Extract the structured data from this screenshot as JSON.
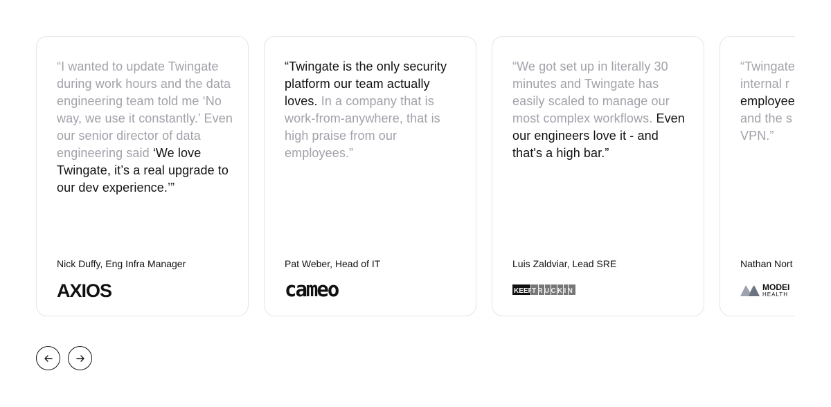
{
  "testimonials": [
    {
      "quote_muted": "“I wanted to update Twingate during work hours and the data engineering team told me ‘No way, we use it constantly.’ Even our senior director of data engineering said ",
      "quote_highlight": "‘We love Twingate, it’s a real upgrade to our dev experience.’”",
      "quote_tail": "",
      "author": "Nick Duffy, Eng Infra Manager",
      "logo": "AXIOS"
    },
    {
      "quote_muted": "",
      "quote_highlight": "“Twingate is the only security platform our team actually loves.",
      "quote_tail": " In a company that is work-from-anywhere, that is high praise from our employees.”",
      "author": "Pat Weber, Head of IT",
      "logo": "cameo"
    },
    {
      "quote_muted": "“We got set up in literally 30 minutes and Twingate has easily scaled to manage our most complex workflows.",
      "quote_highlight": " Even our engineers love it - and that's a high bar.”",
      "quote_tail": "",
      "author": "Luis Zaldviar, Lead SRE",
      "logo": "KEEPTRUCKIN",
      "logo_keep": "KEEP",
      "logo_truckin": "TRUCKIN"
    },
    {
      "quote_muted": "“Twingate puzzle pie our acces internal r",
      "quote_highlight": "employee",
      "quote_tail": "and the s sleep bet that we u VPN.”",
      "author": "Nathan Nort",
      "logo": "MODERN HEALTH",
      "logo_top": "MODEI",
      "logo_bottom": "HEALTH"
    }
  ],
  "nav": {
    "prev_icon": "arrow-left-icon",
    "next_icon": "arrow-right-icon"
  },
  "colors": {
    "muted_text": "#a1a1aa",
    "strong_text": "#111111",
    "card_border": "#e4e4e7"
  }
}
